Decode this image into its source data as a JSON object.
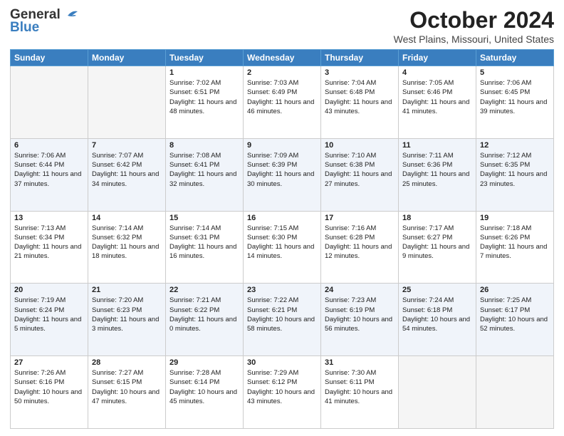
{
  "header": {
    "logo_line1": "General",
    "logo_line2": "Blue",
    "title": "October 2024",
    "location": "West Plains, Missouri, United States"
  },
  "weekdays": [
    "Sunday",
    "Monday",
    "Tuesday",
    "Wednesday",
    "Thursday",
    "Friday",
    "Saturday"
  ],
  "weeks": [
    [
      {
        "day": "",
        "info": ""
      },
      {
        "day": "",
        "info": ""
      },
      {
        "day": "1",
        "info": "Sunrise: 7:02 AM\nSunset: 6:51 PM\nDaylight: 11 hours and 48 minutes."
      },
      {
        "day": "2",
        "info": "Sunrise: 7:03 AM\nSunset: 6:49 PM\nDaylight: 11 hours and 46 minutes."
      },
      {
        "day": "3",
        "info": "Sunrise: 7:04 AM\nSunset: 6:48 PM\nDaylight: 11 hours and 43 minutes."
      },
      {
        "day": "4",
        "info": "Sunrise: 7:05 AM\nSunset: 6:46 PM\nDaylight: 11 hours and 41 minutes."
      },
      {
        "day": "5",
        "info": "Sunrise: 7:06 AM\nSunset: 6:45 PM\nDaylight: 11 hours and 39 minutes."
      }
    ],
    [
      {
        "day": "6",
        "info": "Sunrise: 7:06 AM\nSunset: 6:44 PM\nDaylight: 11 hours and 37 minutes."
      },
      {
        "day": "7",
        "info": "Sunrise: 7:07 AM\nSunset: 6:42 PM\nDaylight: 11 hours and 34 minutes."
      },
      {
        "day": "8",
        "info": "Sunrise: 7:08 AM\nSunset: 6:41 PM\nDaylight: 11 hours and 32 minutes."
      },
      {
        "day": "9",
        "info": "Sunrise: 7:09 AM\nSunset: 6:39 PM\nDaylight: 11 hours and 30 minutes."
      },
      {
        "day": "10",
        "info": "Sunrise: 7:10 AM\nSunset: 6:38 PM\nDaylight: 11 hours and 27 minutes."
      },
      {
        "day": "11",
        "info": "Sunrise: 7:11 AM\nSunset: 6:36 PM\nDaylight: 11 hours and 25 minutes."
      },
      {
        "day": "12",
        "info": "Sunrise: 7:12 AM\nSunset: 6:35 PM\nDaylight: 11 hours and 23 minutes."
      }
    ],
    [
      {
        "day": "13",
        "info": "Sunrise: 7:13 AM\nSunset: 6:34 PM\nDaylight: 11 hours and 21 minutes."
      },
      {
        "day": "14",
        "info": "Sunrise: 7:14 AM\nSunset: 6:32 PM\nDaylight: 11 hours and 18 minutes."
      },
      {
        "day": "15",
        "info": "Sunrise: 7:14 AM\nSunset: 6:31 PM\nDaylight: 11 hours and 16 minutes."
      },
      {
        "day": "16",
        "info": "Sunrise: 7:15 AM\nSunset: 6:30 PM\nDaylight: 11 hours and 14 minutes."
      },
      {
        "day": "17",
        "info": "Sunrise: 7:16 AM\nSunset: 6:28 PM\nDaylight: 11 hours and 12 minutes."
      },
      {
        "day": "18",
        "info": "Sunrise: 7:17 AM\nSunset: 6:27 PM\nDaylight: 11 hours and 9 minutes."
      },
      {
        "day": "19",
        "info": "Sunrise: 7:18 AM\nSunset: 6:26 PM\nDaylight: 11 hours and 7 minutes."
      }
    ],
    [
      {
        "day": "20",
        "info": "Sunrise: 7:19 AM\nSunset: 6:24 PM\nDaylight: 11 hours and 5 minutes."
      },
      {
        "day": "21",
        "info": "Sunrise: 7:20 AM\nSunset: 6:23 PM\nDaylight: 11 hours and 3 minutes."
      },
      {
        "day": "22",
        "info": "Sunrise: 7:21 AM\nSunset: 6:22 PM\nDaylight: 11 hours and 0 minutes."
      },
      {
        "day": "23",
        "info": "Sunrise: 7:22 AM\nSunset: 6:21 PM\nDaylight: 10 hours and 58 minutes."
      },
      {
        "day": "24",
        "info": "Sunrise: 7:23 AM\nSunset: 6:19 PM\nDaylight: 10 hours and 56 minutes."
      },
      {
        "day": "25",
        "info": "Sunrise: 7:24 AM\nSunset: 6:18 PM\nDaylight: 10 hours and 54 minutes."
      },
      {
        "day": "26",
        "info": "Sunrise: 7:25 AM\nSunset: 6:17 PM\nDaylight: 10 hours and 52 minutes."
      }
    ],
    [
      {
        "day": "27",
        "info": "Sunrise: 7:26 AM\nSunset: 6:16 PM\nDaylight: 10 hours and 50 minutes."
      },
      {
        "day": "28",
        "info": "Sunrise: 7:27 AM\nSunset: 6:15 PM\nDaylight: 10 hours and 47 minutes."
      },
      {
        "day": "29",
        "info": "Sunrise: 7:28 AM\nSunset: 6:14 PM\nDaylight: 10 hours and 45 minutes."
      },
      {
        "day": "30",
        "info": "Sunrise: 7:29 AM\nSunset: 6:12 PM\nDaylight: 10 hours and 43 minutes."
      },
      {
        "day": "31",
        "info": "Sunrise: 7:30 AM\nSunset: 6:11 PM\nDaylight: 10 hours and 41 minutes."
      },
      {
        "day": "",
        "info": ""
      },
      {
        "day": "",
        "info": ""
      }
    ]
  ]
}
